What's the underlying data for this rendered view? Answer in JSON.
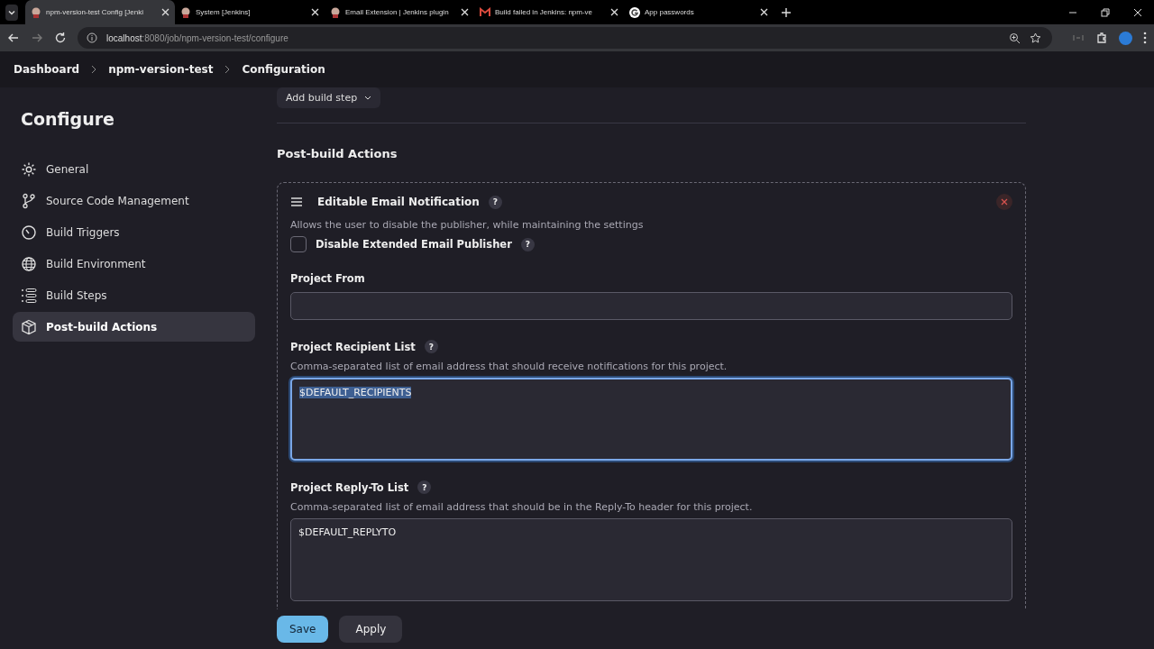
{
  "browser": {
    "tabs": [
      {
        "title": "npm-version-test Config [Jenki",
        "selected": true
      },
      {
        "title": "System [Jenkins]",
        "selected": false
      },
      {
        "title": "Email Extension | Jenkins plugin",
        "selected": false
      },
      {
        "title": "Build failed in Jenkins: npm-ve",
        "selected": false
      },
      {
        "title": "App passwords",
        "selected": false
      }
    ],
    "url_host": "localhost",
    "url_rest": ":8080/job/npm-version-test/configure"
  },
  "breadcrumbs": [
    "Dashboard",
    "npm-version-test",
    "Configuration"
  ],
  "sidebar": {
    "title": "Configure",
    "items": [
      {
        "label": "General",
        "selected": false
      },
      {
        "label": "Source Code Management",
        "selected": false
      },
      {
        "label": "Build Triggers",
        "selected": false
      },
      {
        "label": "Build Environment",
        "selected": false
      },
      {
        "label": "Build Steps",
        "selected": false
      },
      {
        "label": "Post-build Actions",
        "selected": true
      }
    ]
  },
  "main": {
    "add_button": "Add build step",
    "section_title": "Post-build Actions",
    "publisher": {
      "title": "Editable Email Notification",
      "help": "?",
      "description": "Allows the user to disable the publisher, while maintaining the settings",
      "checkbox": {
        "label": "Disable Extended Email Publisher",
        "checked": false,
        "help": "?"
      },
      "fields": [
        {
          "label": "Project From",
          "kind": "input"
        },
        {
          "label": "Project Recipient List",
          "help": "?",
          "description": "Comma-separated list of email address that should receive notifications for this project.",
          "kind": "textarea",
          "value": "$DEFAULT_RECIPIENTS",
          "focused": true
        },
        {
          "label": "Project Reply-To List",
          "help": "?",
          "description": "Comma-separated list of email address that should be in the Reply-To header for this project.",
          "kind": "textarea",
          "value": "$DEFAULT_REPLYTO",
          "focused": false
        }
      ]
    }
  },
  "buttons": [
    {
      "label": "Save",
      "kind": "primary"
    },
    {
      "label": "Apply",
      "kind": "secondary"
    }
  ]
}
